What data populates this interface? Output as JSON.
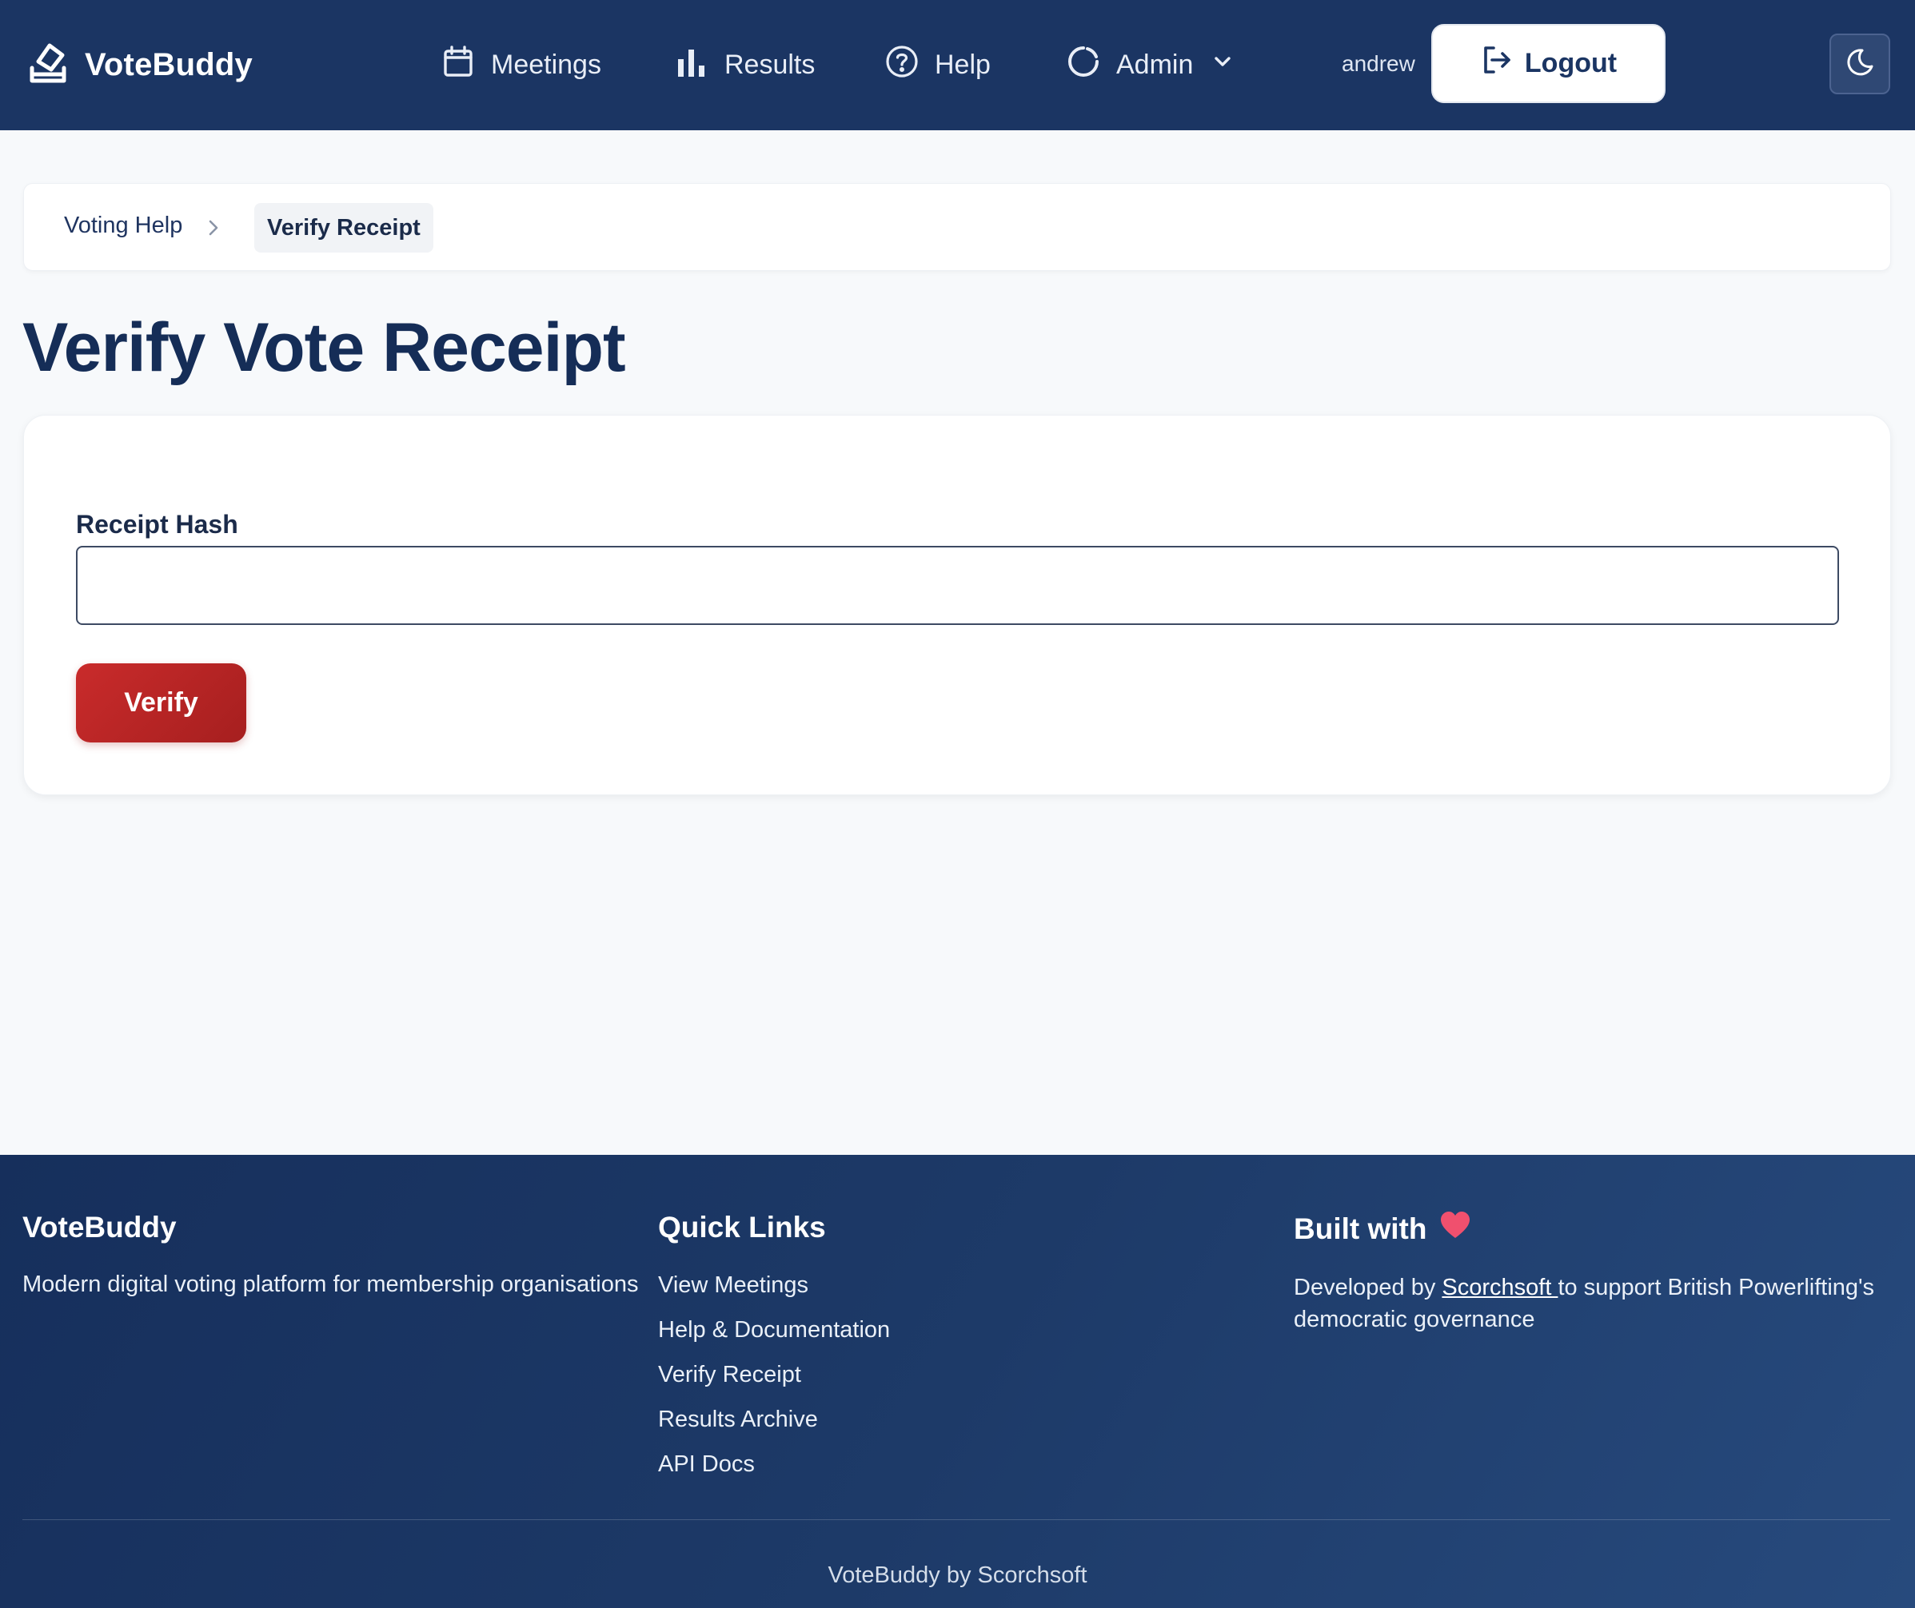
{
  "nav": {
    "brand": "VoteBuddy",
    "links": [
      {
        "label": "Meetings",
        "icon": "calendar-icon"
      },
      {
        "label": "Results",
        "icon": "bar-chart-icon"
      },
      {
        "label": "Help",
        "icon": "question-circle-icon"
      },
      {
        "label": "Admin",
        "icon": "loading-circle-icon"
      }
    ],
    "user": "andrew",
    "logout_label": "Logout",
    "theme_toggle_icon": "moon-icon"
  },
  "breadcrumb": {
    "items": [
      "Voting Help",
      "Verify Receipt"
    ]
  },
  "page": {
    "title": "Verify Vote Receipt"
  },
  "form": {
    "receipt_label": "Receipt Hash",
    "receipt_value": "",
    "receipt_placeholder": "",
    "submit_label": "Verify"
  },
  "footer": {
    "brand_title": "VoteBuddy",
    "tagline": "Modern digital voting platform for membership organisations",
    "links_title": "Quick Links",
    "links": [
      "View Meetings",
      "Help & Documentation",
      "Verify Receipt",
      "Results Archive",
      "API Docs"
    ],
    "built_title": "Built with",
    "built_icon": "heart-icon",
    "dev_prefix": "Developed by ",
    "dev_link": "Scorchsoft ",
    "dev_suffix": "to support British Powerlifting's democratic governance",
    "copyright": "VoteBuddy by Scorchsoft"
  },
  "colors": {
    "nav_bg": "#1b3563",
    "accent_red": "#c92b2b",
    "title": "#152d57",
    "heart": "#f0506e"
  }
}
